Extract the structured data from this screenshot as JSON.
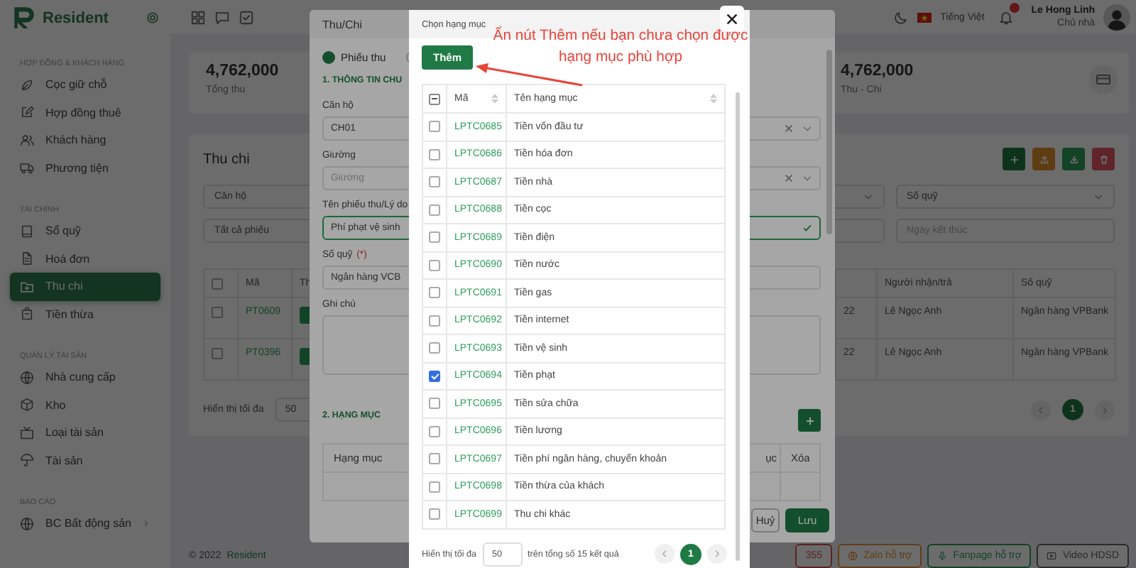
{
  "sidebar": {
    "brand": "Resident",
    "sections": [
      {
        "title": "HỢP ĐỒNG & KHÁCH HÀNG",
        "items": [
          {
            "label": "Cọc giữ chỗ",
            "selected": false,
            "has_submenu": false
          },
          {
            "label": "Hợp đồng thuê",
            "selected": false,
            "has_submenu": false
          },
          {
            "label": "Khách hàng",
            "selected": false,
            "has_submenu": false
          },
          {
            "label": "Phương tiện",
            "selected": false,
            "has_submenu": false
          }
        ]
      },
      {
        "title": "TÀI CHÍNH",
        "items": [
          {
            "label": "Sổ quỹ",
            "selected": false,
            "has_submenu": false
          },
          {
            "label": "Hoá đơn",
            "selected": false,
            "has_submenu": false
          },
          {
            "label": "Thu chi",
            "selected": true,
            "has_submenu": false
          },
          {
            "label": "Tiền thừa",
            "selected": false,
            "has_submenu": false
          }
        ]
      },
      {
        "title": "QUẢN LÝ TÀI SẢN",
        "items": [
          {
            "label": "Nhà cung cấp",
            "selected": false,
            "has_submenu": false
          },
          {
            "label": "Kho",
            "selected": false,
            "has_submenu": false
          },
          {
            "label": "Loại tài sản",
            "selected": false,
            "has_submenu": false
          },
          {
            "label": "Tài sản",
            "selected": false,
            "has_submenu": false
          }
        ]
      },
      {
        "title": "BÁO CÁO",
        "items": [
          {
            "label": "BC Bất động sản",
            "selected": false,
            "has_submenu": true
          }
        ]
      }
    ]
  },
  "topbar": {
    "language": "Tiếng Việt",
    "user_name": "Le Hong Linh",
    "user_role": "Chủ nhà"
  },
  "stats": [
    {
      "value": "4,762,000",
      "label": "Tổng thu"
    },
    {
      "value": "4,762,000",
      "label": "Thu - Chi"
    }
  ],
  "transactions": {
    "title": "Thu chi",
    "filters": [
      {
        "kind": "select",
        "value": "Căn hộ"
      },
      {
        "kind": "select",
        "value": "Số quỹ"
      },
      {
        "kind": "select",
        "value": "Tất cả phiếu"
      },
      {
        "kind": "date",
        "placeholder": "Ngày kết thúc"
      }
    ],
    "select_all_checked": false,
    "columns": [
      "Mã",
      "Th",
      "Người nhận/trả",
      "Số quỹ"
    ],
    "rows": [
      {
        "checked": false,
        "code": "PT0609",
        "column_4": "22",
        "payer": "Lê Ngọc Anh",
        "fund": "Ngân hàng VPBank"
      },
      {
        "checked": false,
        "code": "PT0396",
        "column_4": "22",
        "payer": "Lê Ngọc Anh",
        "fund": "Ngân hàng VPBank"
      }
    ],
    "page_size_label": "Hiển thị tối đa",
    "page_size": "50",
    "pages": [
      {
        "label": "1",
        "selected": true
      }
    ]
  },
  "footer": {
    "copyright": "© 2022",
    "brand": "Resident",
    "support_buttons": [
      {
        "kind": "hotline",
        "label": "355"
      },
      {
        "kind": "zalo",
        "label": "Zalo hỗ trợ"
      },
      {
        "kind": "fanpage",
        "label": "Fanpage hỗ trợ"
      },
      {
        "kind": "video",
        "label": "Video HDSD"
      }
    ]
  },
  "thu_chi_dialog": {
    "title": "Thu/Chi",
    "types": [
      {
        "label": "Phiếu thu",
        "selected": true
      },
      {
        "selected": false
      }
    ],
    "section_1": "1. THÔNG TIN CHU",
    "fields": [
      {
        "kind": "select",
        "label": "Căn hộ",
        "value": "CH01",
        "clearable": true,
        "valid": false
      },
      {
        "kind": "select",
        "label": "Giường",
        "placeholder": "Giường",
        "clearable": true,
        "valid": false
      },
      {
        "kind": "text",
        "label": "Tên phiếu thu/Lý do",
        "value": "Phí phạt vệ sinh",
        "clearable": false,
        "valid": true
      },
      {
        "kind": "select",
        "label": "Số quỹ",
        "required_mark": "(*)",
        "value": "Ngân hàng VCB",
        "clearable": false,
        "valid": false
      },
      {
        "kind": "textarea",
        "label": "Ghi chú",
        "clearable": false,
        "valid": false
      }
    ],
    "section_2": "2. HẠNG MỤC",
    "item_columns": [
      "Hạng mục",
      "ục",
      "Xóa"
    ],
    "buttons": [
      {
        "kind": "secondary",
        "label": "Huỷ"
      },
      {
        "kind": "primary",
        "label": "Lưu"
      }
    ]
  },
  "category_dialog": {
    "title": "Chọn hạng mục",
    "add_button": "Thêm",
    "select_all_partial": true,
    "columns": [
      "Mã",
      "Tên hạng mục"
    ],
    "rows": [
      {
        "code": "LPTC0685",
        "name": "Tiền vốn đầu tư",
        "checked": false
      },
      {
        "code": "LPTC0686",
        "name": "Tiền hóa đơn",
        "checked": false
      },
      {
        "code": "LPTC0687",
        "name": "Tiền nhà",
        "checked": false
      },
      {
        "code": "LPTC0688",
        "name": "Tiền cọc",
        "checked": false
      },
      {
        "code": "LPTC0689",
        "name": "Tiền điện",
        "checked": false
      },
      {
        "code": "LPTC0690",
        "name": "Tiền nước",
        "checked": false
      },
      {
        "code": "LPTC0691",
        "name": "Tiền gas",
        "checked": false
      },
      {
        "code": "LPTC0692",
        "name": "Tiền internet",
        "checked": false
      },
      {
        "code": "LPTC0693",
        "name": "Tiền vệ sinh",
        "checked": false
      },
      {
        "code": "LPTC0694",
        "name": "Tiền phạt",
        "checked": true
      },
      {
        "code": "LPTC0695",
        "name": "Tiền sửa chữa",
        "checked": false
      },
      {
        "code": "LPTC0696",
        "name": "Tiền lương",
        "checked": false
      },
      {
        "code": "LPTC0697",
        "name": "Tiền phí ngân hàng, chuyển khoản",
        "checked": false
      },
      {
        "code": "LPTC0698",
        "name": "Tiền thừa của khách",
        "checked": false
      },
      {
        "code": "LPTC0699",
        "name": "Thu chi khác",
        "checked": false
      }
    ],
    "page_size_label": "Hiển thị tối đa",
    "page_size": "50",
    "summary": "trên tổng số 15 kết quả",
    "pages": [
      {
        "label": "1",
        "selected": true
      }
    ]
  },
  "annotation": {
    "lines": [
      "Ấn nút Thêm nếu bạn chưa chọn được",
      "hạng mục phù hợp"
    ]
  }
}
